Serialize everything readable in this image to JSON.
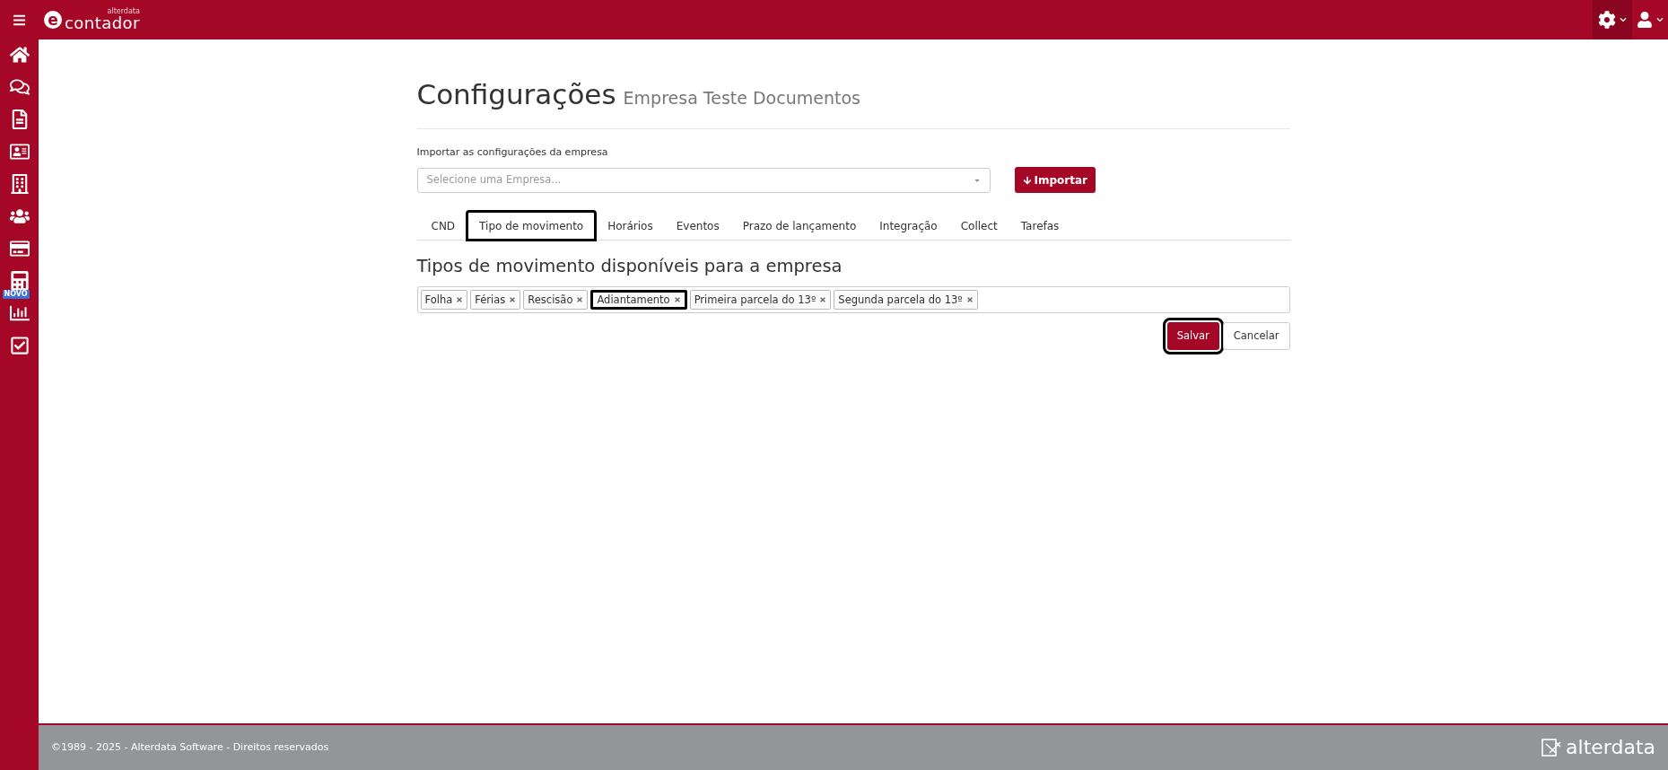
{
  "header": {
    "logo_letter": "e",
    "brand": "contador",
    "brand_small": "alterdata"
  },
  "sidebar": {
    "new_badge": "NOVO"
  },
  "page": {
    "title": "Configurações",
    "subtitle": "Empresa Teste Documentos"
  },
  "import": {
    "label": "Importar as configurações da empresa",
    "placeholder": "Selecione uma Empresa...",
    "button": "Importar"
  },
  "tabs": [
    {
      "label": "CND",
      "selected": false,
      "highlighted": false
    },
    {
      "label": "Tipo de movimento",
      "selected": true,
      "highlighted": true
    },
    {
      "label": "Horários",
      "selected": false,
      "highlighted": false
    },
    {
      "label": "Eventos",
      "selected": false,
      "highlighted": false
    },
    {
      "label": "Prazo de lançamento",
      "selected": false,
      "highlighted": false
    },
    {
      "label": "Integração",
      "selected": false,
      "highlighted": false
    },
    {
      "label": "Collect",
      "selected": false,
      "highlighted": false
    },
    {
      "label": "Tarefas",
      "selected": false,
      "highlighted": false
    }
  ],
  "section_title": "Tipos de movimento disponíveis para a empresa",
  "tags": [
    {
      "label": "Folha",
      "highlighted": false
    },
    {
      "label": "Férias",
      "highlighted": false
    },
    {
      "label": "Rescisão",
      "highlighted": false
    },
    {
      "label": "Adiantamento",
      "highlighted": true
    },
    {
      "label": "Primeira parcela do 13º",
      "highlighted": false
    },
    {
      "label": "Segunda parcela do 13º",
      "highlighted": false
    }
  ],
  "buttons": [
    {
      "label": "Salvar",
      "kind": "primary",
      "highlighted": true
    },
    {
      "label": "Cancelar",
      "kind": "secondary",
      "highlighted": false
    }
  ],
  "footer": {
    "copyright": "©1989 - 2025 - Alterdata Software - Direitos reservados",
    "logo": "alterdata"
  }
}
